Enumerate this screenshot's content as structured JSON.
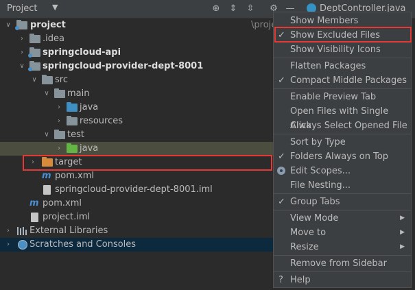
{
  "panel": {
    "title": "Project",
    "caret": "▼"
  },
  "editor_tab": {
    "label": "DeptController.java"
  },
  "toolbar": {
    "locate": "⊕",
    "expand": "⇕",
    "collapse": "⇳",
    "gear": "⚙",
    "hide": "—"
  },
  "tree": [
    {
      "label": "project",
      "suffix": "\\proje",
      "bold": true
    },
    {
      "label": ".idea"
    },
    {
      "label": "springcloud-api",
      "bold": true
    },
    {
      "label": "springcloud-provider-dept-8001",
      "bold": true
    },
    {
      "label": "src"
    },
    {
      "label": "main"
    },
    {
      "label": "java"
    },
    {
      "label": "resources"
    },
    {
      "label": "test"
    },
    {
      "label": "java"
    },
    {
      "label": "target"
    },
    {
      "label": "pom.xml"
    },
    {
      "label": "springcloud-provider-dept-8001.iml"
    },
    {
      "label": "pom.xml"
    },
    {
      "label": "project.iml"
    },
    {
      "label": "External Libraries"
    },
    {
      "label": "Scratches and Consoles"
    }
  ],
  "menu": [
    {
      "label": "Show Members",
      "checked": false
    },
    {
      "label": "Show Excluded Files",
      "checked": true
    },
    {
      "label": "Show Visibility Icons",
      "checked": false
    },
    {
      "label": "Flatten Packages",
      "checked": false
    },
    {
      "label": "Compact Middle Packages",
      "checked": true
    },
    {
      "label": "Enable Preview Tab",
      "checked": false
    },
    {
      "label": "Open Files with Single Click",
      "checked": false
    },
    {
      "label": "Always Select Opened File",
      "checked": false
    },
    {
      "label": "Sort by Type",
      "checked": false
    },
    {
      "label": "Folders Always on Top",
      "checked": true
    },
    {
      "label": "Edit Scopes...",
      "checked": false
    },
    {
      "label": "File Nesting...",
      "checked": false
    },
    {
      "label": "Group Tabs",
      "checked": true
    },
    {
      "label": "View Mode",
      "submenu": true
    },
    {
      "label": "Move to",
      "submenu": true
    },
    {
      "label": "Resize",
      "submenu": true
    },
    {
      "label": "Remove from Sidebar",
      "checked": false
    },
    {
      "label": "Help",
      "checked": false
    }
  ],
  "glyphs": {
    "check": "✓",
    "submenu": "▶",
    "expanded": "∨",
    "collapsed": "›",
    "help": "?"
  },
  "colors": {
    "highlight": "#e53935",
    "selection": "#0d293e",
    "excluded_folder": "#d68a3a",
    "source_folder": "#3d8fc4",
    "test_folder": "#62b543"
  }
}
